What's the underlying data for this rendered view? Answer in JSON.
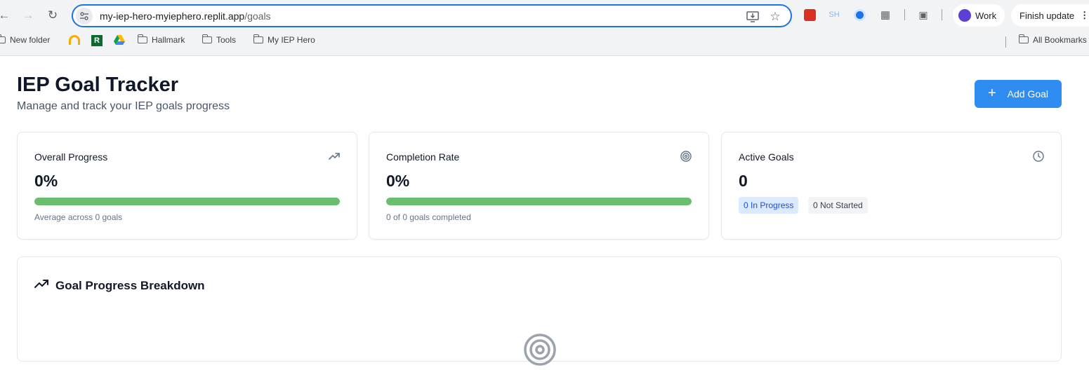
{
  "browser": {
    "url_host": "my-iep-hero-myiephero.replit.app",
    "url_path": "/goals",
    "extension_sh": "SH",
    "profile_label": "Work",
    "update_label": "Finish update",
    "bookmarks": [
      "New folder",
      "Hallmark",
      "Tools",
      "My IEP Hero"
    ],
    "all_bookmarks_label": "All Bookmarks"
  },
  "page": {
    "title": "IEP Goal Tracker",
    "subtitle": "Manage and track your IEP goals progress",
    "add_goal_label": "Add Goal"
  },
  "cards": {
    "overall": {
      "label": "Overall Progress",
      "value": "0%",
      "note": "Average across 0 goals",
      "icon": "trending-up-icon"
    },
    "completion": {
      "label": "Completion Rate",
      "value": "0%",
      "note": "0 of 0 goals completed",
      "icon": "target-icon"
    },
    "active": {
      "label": "Active Goals",
      "value": "0",
      "badge_in_progress": "0 In Progress",
      "badge_not_started": "0 Not Started",
      "icon": "clock-icon"
    }
  },
  "breakdown": {
    "title": "Goal Progress Breakdown",
    "icon": "trending-up-icon"
  },
  "colors": {
    "accent": "#2f8cf0",
    "progress_bar": "#69bd6e",
    "badge_blue_bg": "#dbeafe"
  }
}
